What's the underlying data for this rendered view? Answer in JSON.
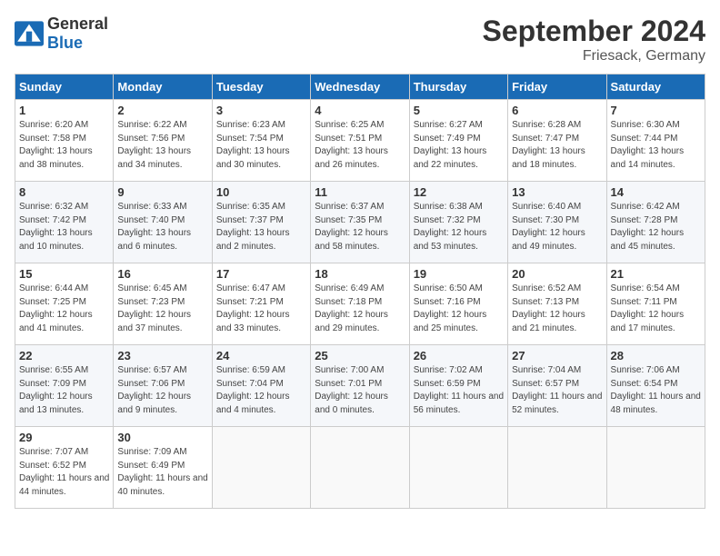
{
  "logo": {
    "general": "General",
    "blue": "Blue"
  },
  "header": {
    "month": "September 2024",
    "location": "Friesack, Germany"
  },
  "weekdays": [
    "Sunday",
    "Monday",
    "Tuesday",
    "Wednesday",
    "Thursday",
    "Friday",
    "Saturday"
  ],
  "weeks": [
    [
      {
        "day": "1",
        "sunrise": "6:20 AM",
        "sunset": "7:58 PM",
        "daylight": "13 hours and 38 minutes."
      },
      {
        "day": "2",
        "sunrise": "6:22 AM",
        "sunset": "7:56 PM",
        "daylight": "13 hours and 34 minutes."
      },
      {
        "day": "3",
        "sunrise": "6:23 AM",
        "sunset": "7:54 PM",
        "daylight": "13 hours and 30 minutes."
      },
      {
        "day": "4",
        "sunrise": "6:25 AM",
        "sunset": "7:51 PM",
        "daylight": "13 hours and 26 minutes."
      },
      {
        "day": "5",
        "sunrise": "6:27 AM",
        "sunset": "7:49 PM",
        "daylight": "13 hours and 22 minutes."
      },
      {
        "day": "6",
        "sunrise": "6:28 AM",
        "sunset": "7:47 PM",
        "daylight": "13 hours and 18 minutes."
      },
      {
        "day": "7",
        "sunrise": "6:30 AM",
        "sunset": "7:44 PM",
        "daylight": "13 hours and 14 minutes."
      }
    ],
    [
      {
        "day": "8",
        "sunrise": "6:32 AM",
        "sunset": "7:42 PM",
        "daylight": "13 hours and 10 minutes."
      },
      {
        "day": "9",
        "sunrise": "6:33 AM",
        "sunset": "7:40 PM",
        "daylight": "13 hours and 6 minutes."
      },
      {
        "day": "10",
        "sunrise": "6:35 AM",
        "sunset": "7:37 PM",
        "daylight": "13 hours and 2 minutes."
      },
      {
        "day": "11",
        "sunrise": "6:37 AM",
        "sunset": "7:35 PM",
        "daylight": "12 hours and 58 minutes."
      },
      {
        "day": "12",
        "sunrise": "6:38 AM",
        "sunset": "7:32 PM",
        "daylight": "12 hours and 53 minutes."
      },
      {
        "day": "13",
        "sunrise": "6:40 AM",
        "sunset": "7:30 PM",
        "daylight": "12 hours and 49 minutes."
      },
      {
        "day": "14",
        "sunrise": "6:42 AM",
        "sunset": "7:28 PM",
        "daylight": "12 hours and 45 minutes."
      }
    ],
    [
      {
        "day": "15",
        "sunrise": "6:44 AM",
        "sunset": "7:25 PM",
        "daylight": "12 hours and 41 minutes."
      },
      {
        "day": "16",
        "sunrise": "6:45 AM",
        "sunset": "7:23 PM",
        "daylight": "12 hours and 37 minutes."
      },
      {
        "day": "17",
        "sunrise": "6:47 AM",
        "sunset": "7:21 PM",
        "daylight": "12 hours and 33 minutes."
      },
      {
        "day": "18",
        "sunrise": "6:49 AM",
        "sunset": "7:18 PM",
        "daylight": "12 hours and 29 minutes."
      },
      {
        "day": "19",
        "sunrise": "6:50 AM",
        "sunset": "7:16 PM",
        "daylight": "12 hours and 25 minutes."
      },
      {
        "day": "20",
        "sunrise": "6:52 AM",
        "sunset": "7:13 PM",
        "daylight": "12 hours and 21 minutes."
      },
      {
        "day": "21",
        "sunrise": "6:54 AM",
        "sunset": "7:11 PM",
        "daylight": "12 hours and 17 minutes."
      }
    ],
    [
      {
        "day": "22",
        "sunrise": "6:55 AM",
        "sunset": "7:09 PM",
        "daylight": "12 hours and 13 minutes."
      },
      {
        "day": "23",
        "sunrise": "6:57 AM",
        "sunset": "7:06 PM",
        "daylight": "12 hours and 9 minutes."
      },
      {
        "day": "24",
        "sunrise": "6:59 AM",
        "sunset": "7:04 PM",
        "daylight": "12 hours and 4 minutes."
      },
      {
        "day": "25",
        "sunrise": "7:00 AM",
        "sunset": "7:01 PM",
        "daylight": "12 hours and 0 minutes."
      },
      {
        "day": "26",
        "sunrise": "7:02 AM",
        "sunset": "6:59 PM",
        "daylight": "11 hours and 56 minutes."
      },
      {
        "day": "27",
        "sunrise": "7:04 AM",
        "sunset": "6:57 PM",
        "daylight": "11 hours and 52 minutes."
      },
      {
        "day": "28",
        "sunrise": "7:06 AM",
        "sunset": "6:54 PM",
        "daylight": "11 hours and 48 minutes."
      }
    ],
    [
      {
        "day": "29",
        "sunrise": "7:07 AM",
        "sunset": "6:52 PM",
        "daylight": "11 hours and 44 minutes."
      },
      {
        "day": "30",
        "sunrise": "7:09 AM",
        "sunset": "6:49 PM",
        "daylight": "11 hours and 40 minutes."
      },
      null,
      null,
      null,
      null,
      null
    ]
  ]
}
